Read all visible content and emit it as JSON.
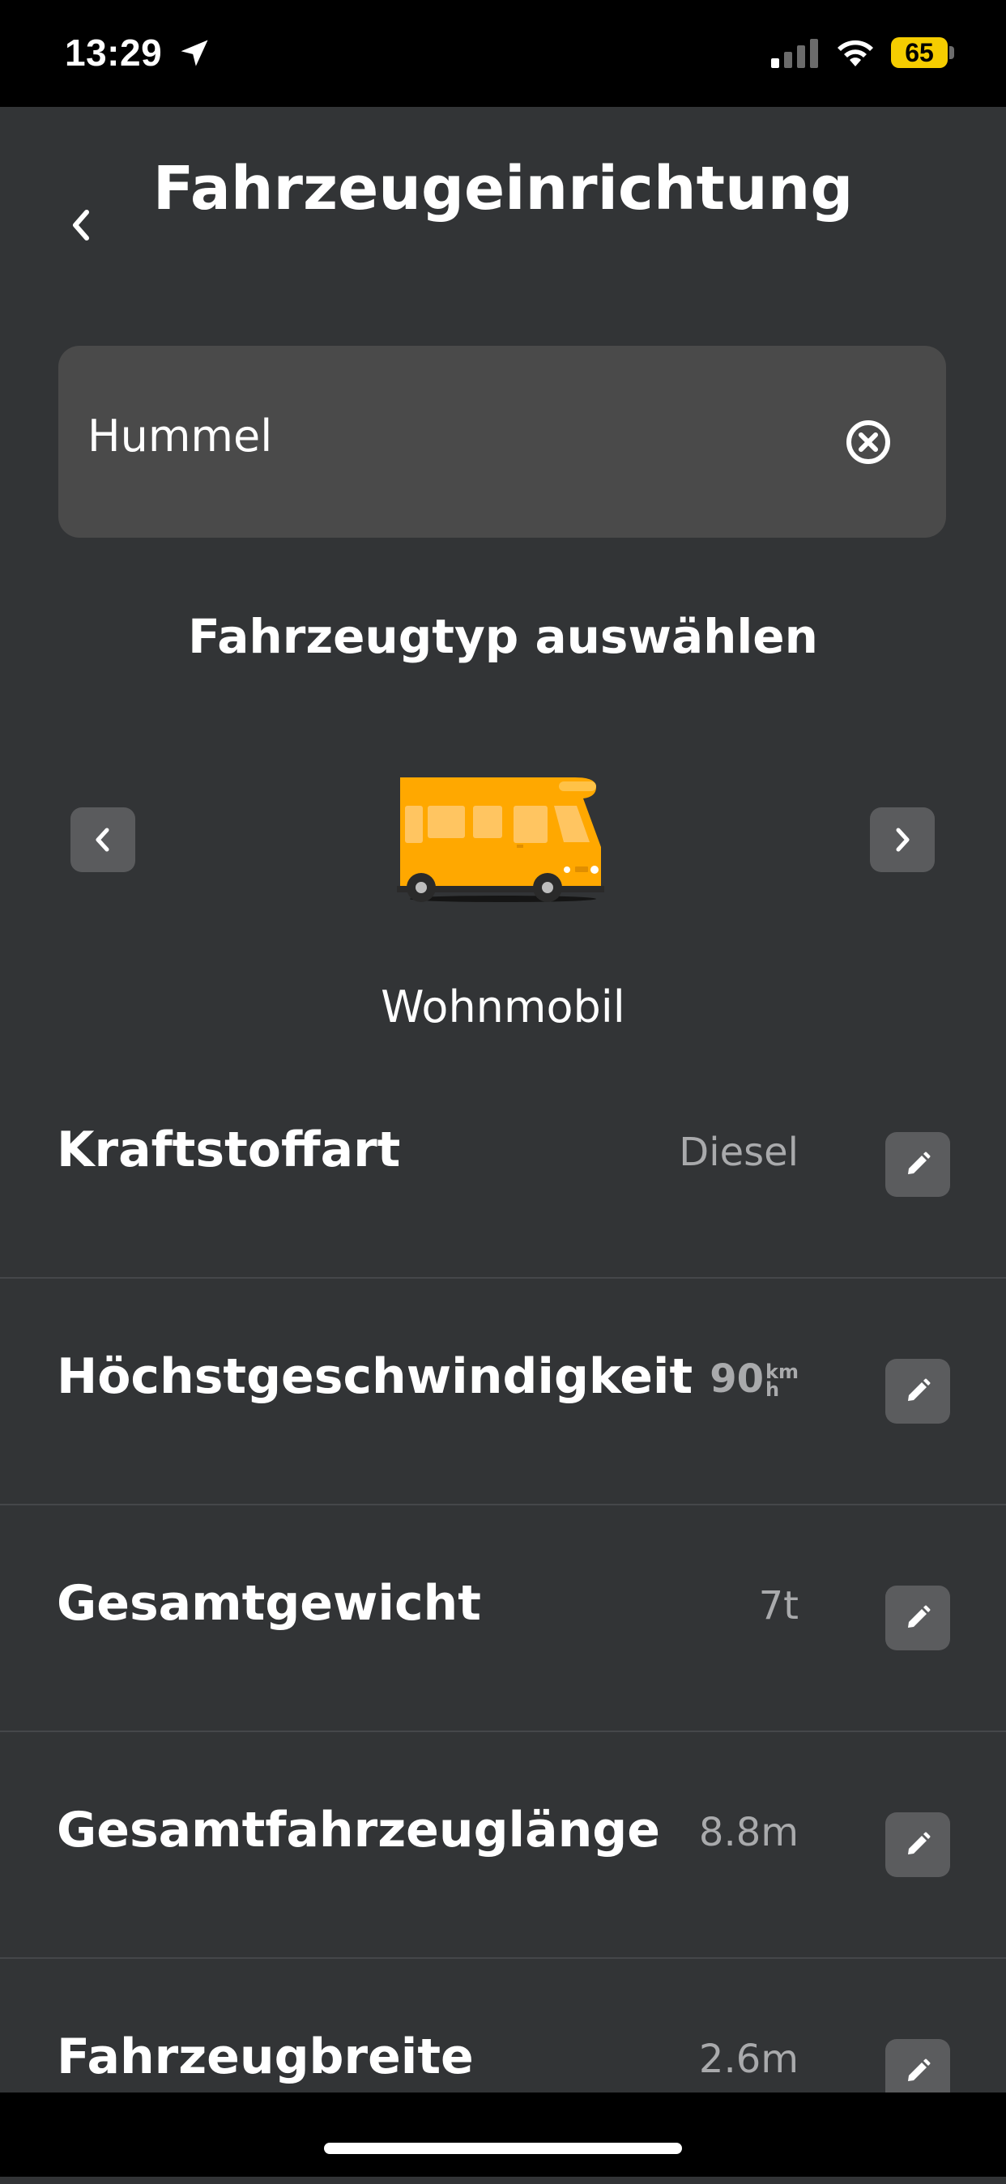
{
  "status_bar": {
    "time": "13:29",
    "battery": "65",
    "icons": [
      "location-arrow-icon",
      "cellular-signal-icon",
      "wifi-icon",
      "battery-icon"
    ]
  },
  "header": {
    "title": "Fahrzeugeinrichtung",
    "back_icon": "chevron-left-icon"
  },
  "name_field": {
    "value": "Hummel",
    "clear_icon": "clear-circle-icon"
  },
  "vehicle_type": {
    "title": "Fahrzeugtyp auswählen",
    "selected": "Wohnmobil",
    "image": "motorhome-icon",
    "accent_color": "#ffa800"
  },
  "settings": [
    {
      "label": "Kraftstoffart",
      "value": "Diesel"
    },
    {
      "label": "Höchstgeschwindigkeit",
      "value": "90",
      "unit_top": "km",
      "unit_bottom": "h"
    },
    {
      "label": "Gesamtgewicht",
      "value": "7t"
    },
    {
      "label": "Gesamtfahrzeuglänge",
      "value": "8.8m"
    },
    {
      "label": "Fahrzeugbreite",
      "value": "2.6m"
    }
  ],
  "colors": {
    "background": "#323436",
    "field": "#4a4a4a",
    "button": "#5b5c5e",
    "value_text": "#a9aaac"
  }
}
